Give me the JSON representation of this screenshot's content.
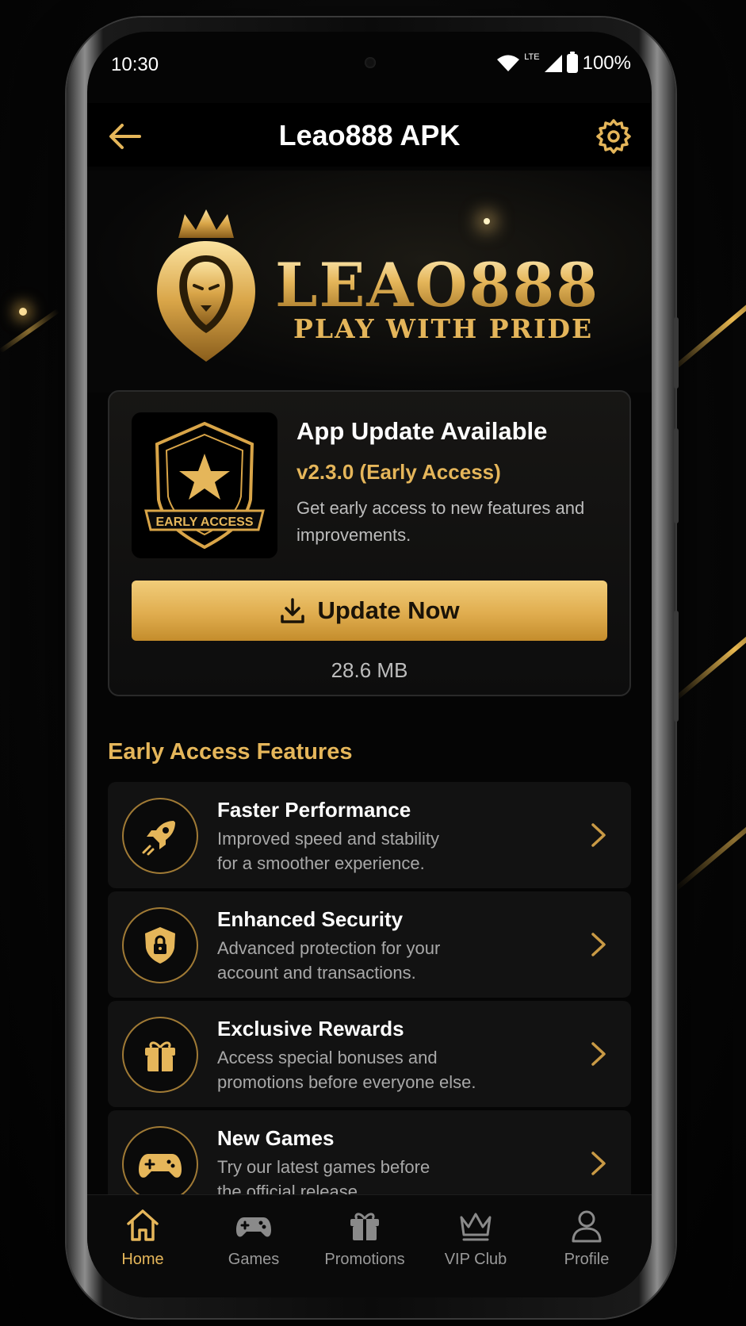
{
  "status_bar": {
    "time": "10:30",
    "network": "LTE",
    "battery": "100%"
  },
  "app_bar": {
    "title": "Leao888 APK"
  },
  "hero": {
    "brand": "LEAO888",
    "tagline": "PLAY WITH PRIDE"
  },
  "update_card": {
    "badge_text": "EARLY ACCESS",
    "title": "App Update Available",
    "version": "v2.3.0 (Early Access)",
    "description": "Get early access to new features and improvements.",
    "button_label": "Update Now",
    "size": "28.6 MB"
  },
  "features": {
    "heading": "Early Access Features",
    "items": [
      {
        "title": "Faster Performance",
        "line1": "Improved speed and stability",
        "line2": "for a smoother experience.",
        "icon": "rocket-icon"
      },
      {
        "title": "Enhanced Security",
        "line1": "Advanced protection for your",
        "line2": "account and transactions.",
        "icon": "shield-lock-icon"
      },
      {
        "title": "Exclusive Rewards",
        "line1": "Access special bonuses and",
        "line2": "promotions before everyone else.",
        "icon": "gift-icon"
      },
      {
        "title": "New Games",
        "line1": "Try our latest games before",
        "line2": "the official release.",
        "icon": "gamepad-icon"
      }
    ]
  },
  "bottom_nav": [
    {
      "label": "Home",
      "active": true
    },
    {
      "label": "Games",
      "active": false
    },
    {
      "label": "Promotions",
      "active": false
    },
    {
      "label": "VIP Club",
      "active": false
    },
    {
      "label": "Profile",
      "active": false
    }
  ],
  "colors": {
    "accent": "#e5b65a",
    "background": "#050505",
    "card": "#121212"
  }
}
